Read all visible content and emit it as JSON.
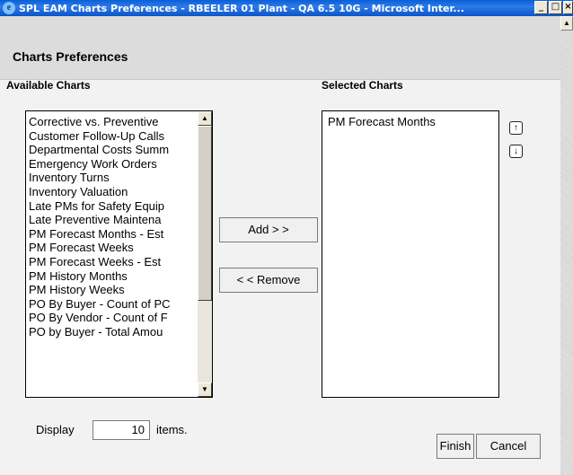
{
  "window": {
    "title": "SPL EAM Charts Preferences - RBEELER 01 Plant - QA 6.5 10G - Microsoft Inter...",
    "minimize": "_",
    "maximize": "□",
    "close": "×"
  },
  "header": {
    "title": "Charts Preferences"
  },
  "available": {
    "label": "Available Charts",
    "items": [
      "Corrective vs. Preventive",
      "Customer Follow-Up Calls",
      "Departmental Costs Summ",
      "Emergency Work Orders",
      "Inventory Turns",
      "Inventory Valuation",
      "Late PMs for Safety Equip",
      "Late Preventive Maintena",
      "PM Forecast Months - Est",
      "PM Forecast Weeks",
      "PM Forecast Weeks - Est",
      "PM History Months",
      "PM History Weeks",
      "PO By Buyer - Count of PC",
      "PO By Vendor - Count of F",
      "PO by Buyer - Total Amou"
    ]
  },
  "buttons": {
    "add": "Add > >",
    "remove": "< < Remove",
    "finish": "Finish",
    "cancel": "Cancel"
  },
  "selected": {
    "label": "Selected Charts",
    "items": [
      "PM Forecast Months"
    ]
  },
  "icons": {
    "move_up": "up-arrow-icon",
    "move_down": "down-arrow-icon"
  },
  "display": {
    "prefix": "Display",
    "value": "10",
    "suffix": "items."
  }
}
